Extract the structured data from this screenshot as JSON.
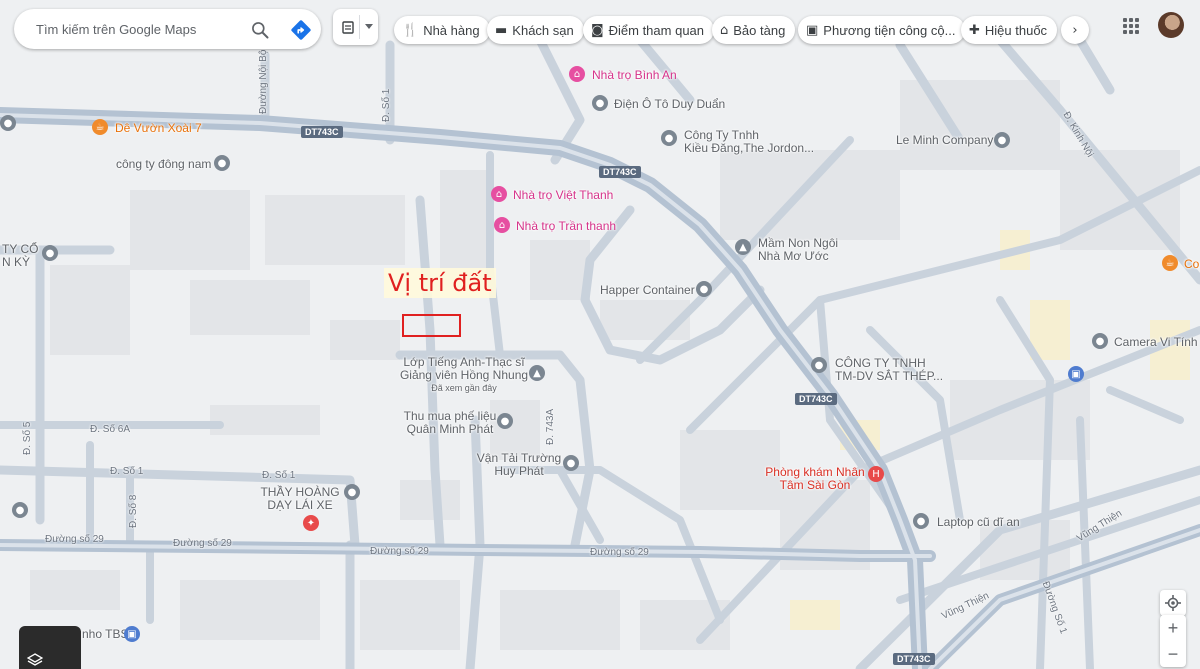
{
  "search": {
    "placeholder": "Tìm kiếm trên Google Maps"
  },
  "chips": [
    {
      "label": "Nhà hàng",
      "icon": "restaurant-icon"
    },
    {
      "label": "Khách sạn",
      "icon": "hotel-icon"
    },
    {
      "label": "Điểm tham quan",
      "icon": "camera-icon"
    },
    {
      "label": "Bảo tàng",
      "icon": "museum-icon"
    },
    {
      "label": "Phương tiện công cộ...",
      "icon": "transit-icon"
    },
    {
      "label": "Hiệu thuốc",
      "icon": "pharmacy-icon"
    }
  ],
  "annotation": {
    "text": "Vị trí đất"
  },
  "places": [
    {
      "name": "Nhà trọ Bình An",
      "type": "lodging"
    },
    {
      "name": "Điện Ô Tô Duy Duẩn",
      "type": "generic"
    },
    {
      "name": "Dê Vườn Xoài 7",
      "type": "restaurant"
    },
    {
      "name": "công ty đông nam",
      "type": "generic"
    },
    {
      "name": "Công Ty Tnhh",
      "name2": "Kiều Đăng,The Jordon...",
      "type": "generic"
    },
    {
      "name": "Le Minh Company",
      "type": "generic"
    },
    {
      "name": "Nhà trọ Việt Thanh",
      "type": "lodging"
    },
    {
      "name": "Nhà trọ Trần thanh",
      "type": "lodging"
    },
    {
      "name": "Mầm Non Ngôi",
      "name2": "Nhà Mơ Ước",
      "type": "school"
    },
    {
      "name": "Happer Container",
      "type": "generic"
    },
    {
      "name": "TY CỔ",
      "name2": "N KỲ",
      "type": "generic"
    },
    {
      "name": "Lớp Tiếng Anh-Thạc sĩ",
      "name2": "Giảng viên Hồng Nhung",
      "name3": "Đã xem gần đây",
      "type": "school"
    },
    {
      "name": "Thu mua phế liệu",
      "name2": "Quân Minh Phát",
      "type": "generic"
    },
    {
      "name": "Vận Tải Trường",
      "name2": "Huy Phát",
      "type": "generic"
    },
    {
      "name": "CÔNG TY TNHH",
      "name2": "TM-DV SẮT THÉP...",
      "type": "generic"
    },
    {
      "name": "Camera Vi Tính",
      "type": "generic"
    },
    {
      "name": "Phòng khám Nhân",
      "name2": "Tâm Sài Gòn",
      "type": "hospital"
    },
    {
      "name": "THẦY HOÀNG",
      "name2": "DẠY LÁI XE",
      "type": "generic"
    },
    {
      "name": "Laptop cũ dĩ an",
      "type": "generic"
    },
    {
      "name": "Co",
      "type": "restaurant"
    },
    {
      "name": "nho TBS",
      "type": "shopping"
    }
  ],
  "roads": {
    "dt743c": "DT743C",
    "d_so1": "Đ. Số 1",
    "d_so5": "Đ. Số 5",
    "d_so6a": "Đ. Số 6A",
    "d_so8": "Đ. Số 8",
    "duong_so29": "Đường số 29",
    "d_743a": "Đ. 743A",
    "duong_noi_bo": "Đường Nội Bộ",
    "d_kinh_noi": "Đ. Kinh Nội",
    "vung_thien": "Vũng Thiện",
    "duong_so1": "Đường Số 1"
  }
}
